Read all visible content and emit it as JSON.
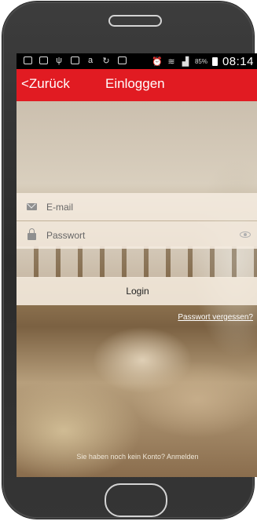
{
  "status_bar": {
    "battery": "85%",
    "time": "08:14"
  },
  "app_bar": {
    "back_label": "<Zurück",
    "title": "Einloggen"
  },
  "form": {
    "email_placeholder": "E-mail",
    "password_placeholder": "Passwort",
    "login_label": "Login",
    "forgot_label": "Passwort vergessen?"
  },
  "footer": {
    "no_account_text": "Sie haben noch kein Konto?",
    "signup_label": "Anmelden"
  },
  "colors": {
    "accent": "#e11b22",
    "device": "#333333"
  }
}
